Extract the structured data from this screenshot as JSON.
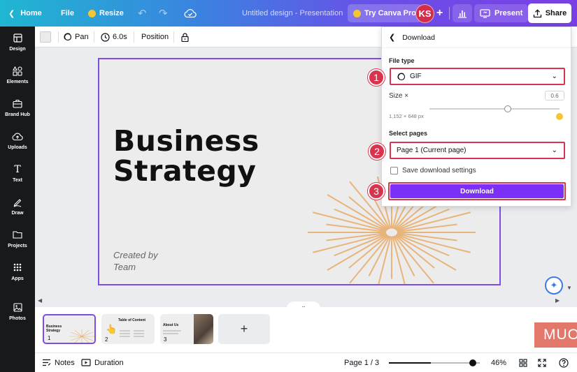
{
  "topbar": {
    "home_label": "Home",
    "file_label": "File",
    "resize_label": "Resize",
    "doc_title": "Untitled design - Presentation",
    "pro_label": "Try Canva Pro",
    "avatar_initials": "KS",
    "present_label": "Present",
    "share_label": "Share"
  },
  "sidebar": {
    "items": [
      {
        "label": "Design",
        "icon": "layout-icon"
      },
      {
        "label": "Elements",
        "icon": "shapes-icon"
      },
      {
        "label": "Brand Hub",
        "icon": "briefcase-icon"
      },
      {
        "label": "Uploads",
        "icon": "upload-cloud-icon"
      },
      {
        "label": "Text",
        "icon": "text-icon"
      },
      {
        "label": "Draw",
        "icon": "pen-icon"
      },
      {
        "label": "Projects",
        "icon": "folder-icon"
      },
      {
        "label": "Apps",
        "icon": "grid-icon"
      },
      {
        "label": "Photos",
        "icon": "image-icon"
      }
    ]
  },
  "toolbar": {
    "pan_label": "Pan",
    "duration_label": "6.0s",
    "position_label": "Position"
  },
  "slide": {
    "title_line1": "Business",
    "title_line2": "Strategy",
    "subtitle_line1": "Created by",
    "subtitle_line2": "Team",
    "accent_color": "#e8b47a",
    "border_color": "#7e4ce0"
  },
  "pages": {
    "thumbs": [
      {
        "num": "1",
        "text": "Business Strategy"
      },
      {
        "num": "2",
        "text": "Table of Content"
      },
      {
        "num": "3",
        "text": "About Us"
      }
    ],
    "add_label": "+",
    "watermark": "MUO"
  },
  "bottombar": {
    "notes_label": "Notes",
    "duration_label": "Duration",
    "page_indicator": "Page 1 / 3",
    "zoom_label": "46%",
    "zoom_fraction": 0.46
  },
  "download_panel": {
    "title": "Download",
    "file_type_label": "File type",
    "file_type_value": "GIF",
    "size_label": "Size ×",
    "size_value": "0.6",
    "size_fraction": 0.6,
    "dimensions": "1,152 × 648 px",
    "select_pages_label": "Select pages",
    "pages_value": "Page 1 (Current page)",
    "save_settings_label": "Save download settings",
    "download_button": "Download",
    "highlight_color": "#d8344d",
    "button_color": "#7b2ff7"
  },
  "annotations": {
    "badges": [
      "1",
      "2",
      "3"
    ]
  }
}
